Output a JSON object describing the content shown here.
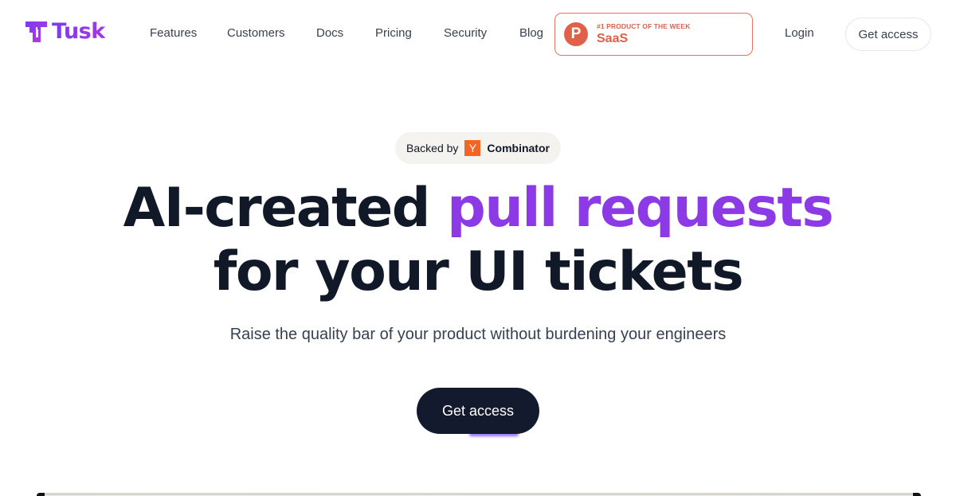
{
  "brand": {
    "name": "Tusk",
    "logo_icon": "tusk-logo-icon",
    "accent_color": "#8b3ae6"
  },
  "nav": {
    "links": [
      {
        "label": "Features"
      },
      {
        "label": "Customers"
      },
      {
        "label": "Docs"
      },
      {
        "label": "Pricing"
      },
      {
        "label": "Security"
      },
      {
        "label": "Blog"
      }
    ],
    "product_hunt_badge": {
      "icon": "product-hunt-icon",
      "icon_letter": "P",
      "caption": "#1 PRODUCT OF THE WEEK",
      "category": "SaaS",
      "color": "#e1604a"
    },
    "login_label": "Login",
    "get_access_label": "Get access"
  },
  "hero": {
    "backed_by": {
      "prefix": "Backed by",
      "yc_logo_letter": "Y",
      "name": "Combinator",
      "yc_color": "#f26522"
    },
    "headline": {
      "part1": "AI-created ",
      "accent": "pull requests",
      "line2": "for your UI tickets"
    },
    "subtitle": "Raise the quality bar of your product without burdening your engineers",
    "cta_label": "Get access"
  }
}
